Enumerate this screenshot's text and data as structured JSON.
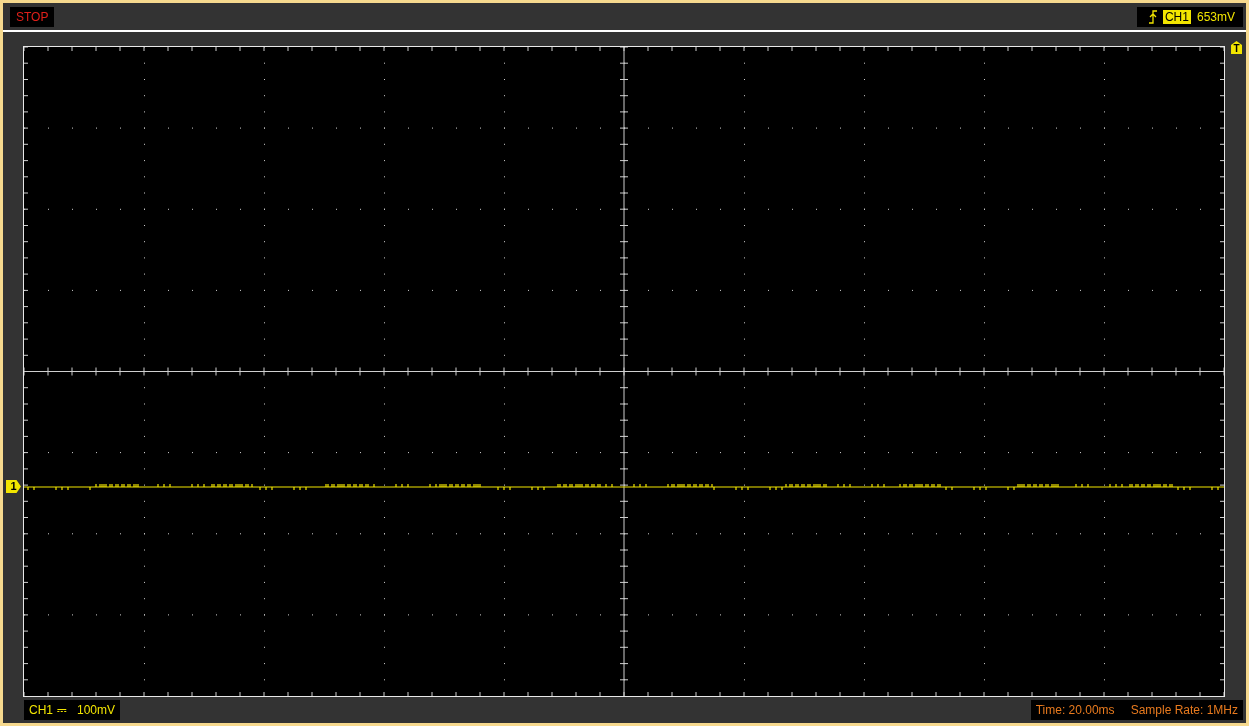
{
  "status": "STOP",
  "trigger": {
    "channel": "CH1",
    "level": "653mV",
    "marker": "T"
  },
  "channel_marker": "1",
  "bottom_bar": {
    "channel": "CH1",
    "coupling": "⎓",
    "scale": "100mV",
    "time": "Time: 20.00ms",
    "sample_rate": "Sample Rate: 1MHz"
  }
}
